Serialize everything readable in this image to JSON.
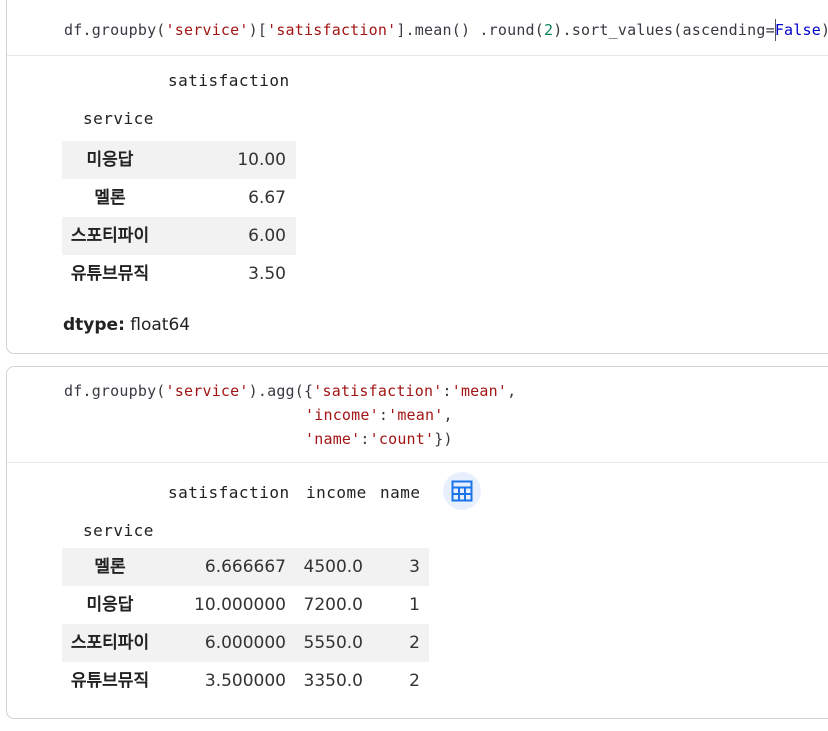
{
  "cell1": {
    "code_tokens": [
      "df.groupby(",
      "'service'",
      ")[",
      "'satisfaction'",
      "].mean() .round(",
      "2",
      ").sort_values(ascending=",
      "False",
      ")"
    ],
    "output": {
      "column_header": "satisfaction",
      "index_name": "service",
      "rows": [
        {
          "label": "미응답",
          "value": "10.00"
        },
        {
          "label": "멜론",
          "value": "6.67"
        },
        {
          "label": "스포티파이",
          "value": "6.00"
        },
        {
          "label": "유튜브뮤직",
          "value": "3.50"
        }
      ],
      "dtype_label": "dtype:",
      "dtype_value": "float64"
    }
  },
  "cell2": {
    "code_line1": [
      "df.groupby(",
      "'service'",
      ").agg({",
      "'satisfaction'",
      ":",
      "'mean'",
      ","
    ],
    "code_line2": [
      "'income'",
      ":",
      "'mean'",
      ","
    ],
    "code_line3": [
      "'name'",
      ":",
      "'count'",
      "})"
    ],
    "output": {
      "columns": [
        "satisfaction",
        "income",
        "name"
      ],
      "index_name": "service",
      "rows": [
        {
          "label": "멜론",
          "satisfaction": "6.666667",
          "income": "4500.0",
          "name": "3"
        },
        {
          "label": "미응답",
          "satisfaction": "10.000000",
          "income": "7200.0",
          "name": "1"
        },
        {
          "label": "스포티파이",
          "satisfaction": "6.000000",
          "income": "5550.0",
          "name": "2"
        },
        {
          "label": "유튜브뮤직",
          "satisfaction": "3.500000",
          "income": "3350.0",
          "name": "2"
        }
      ],
      "table_button_icon": "table-grid-icon"
    }
  },
  "colors": {
    "string": "#a31515",
    "keyword": "#0000cc",
    "number": "#098658",
    "table_button_bg": "#e8f0fe",
    "table_button_icon": "#1a73e8",
    "row_shade": "#f2f2f2"
  }
}
